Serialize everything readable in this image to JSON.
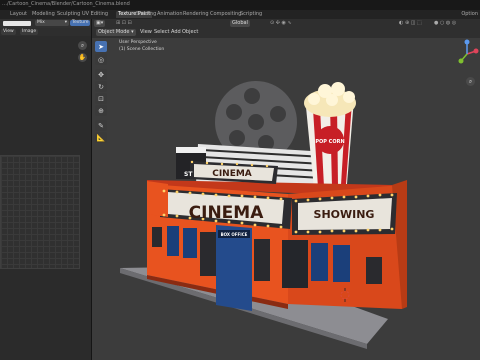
{
  "window": {
    "title": "…/Cartoon_Cinema/Blender/Cartoon_Cinema.blend"
  },
  "workspaces": {
    "tabs": [
      "Layout",
      "Modeling",
      "Sculpting",
      "UV Editing",
      "Texture Paint",
      "Shading",
      "Animation",
      "Rendering",
      "Compositing",
      "Scripting"
    ],
    "active_index": 4,
    "right_label": "Option"
  },
  "uv_editor": {
    "mode_value": "Mix",
    "toolbar": [
      "View",
      "Image"
    ],
    "texture_button": "Texture"
  },
  "viewport": {
    "mode": "Object Mode",
    "menus": [
      "View",
      "Select",
      "Add",
      "Object"
    ],
    "orientation": "Global",
    "perspective_label": "User Perspective",
    "collection_label": "(1) Scene Collection"
  },
  "scene": {
    "roof_sign_text": "CINEMA",
    "main_sign_text": "CINEMA",
    "side_sign_text": "SHOWING",
    "box_office_text": "BOX OFFICE",
    "popcorn_text": "POP CORN",
    "clapper_text": "ST",
    "colors": {
      "wall": "#e8531f",
      "sign": "#e8e4dc",
      "letter": "#3a1c10",
      "trim": "#b22a14",
      "window": "#1b3f7a",
      "marquee": "#2c2c30",
      "bulb": "#ffd36a",
      "accent": "#4772b3"
    }
  }
}
